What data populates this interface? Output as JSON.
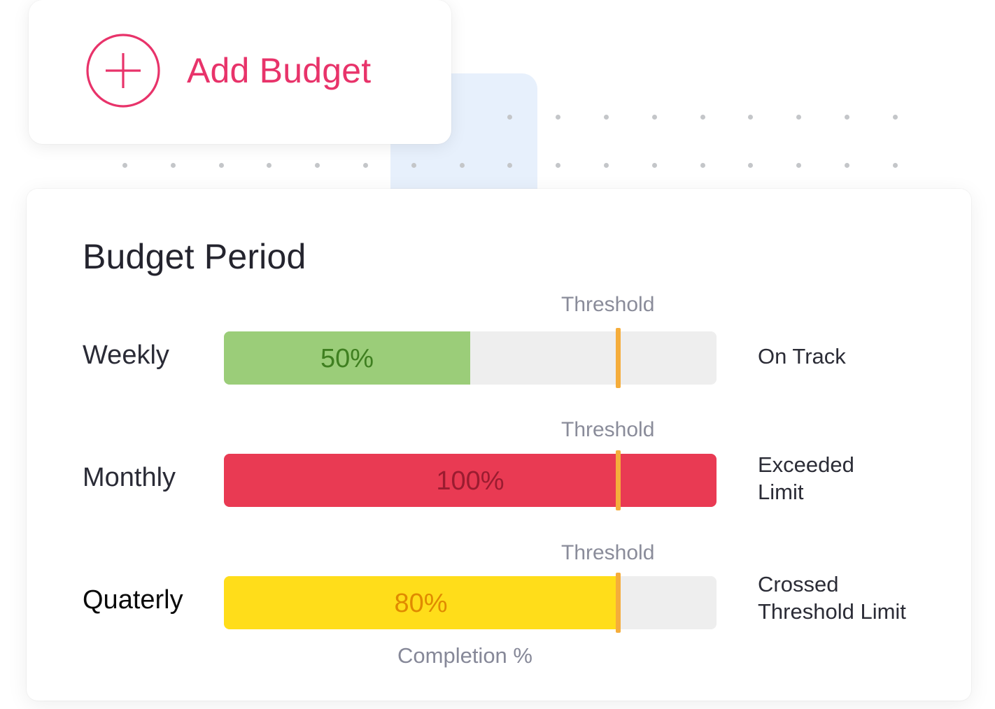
{
  "add_budget": {
    "label": "Add Budget",
    "icon": "plus-circle-icon",
    "color": "#e8336a"
  },
  "card": {
    "title": "Budget Period",
    "axis_label": "Completion %"
  },
  "chart_data": {
    "type": "bar",
    "orientation": "horizontal",
    "title": "Budget Period",
    "xlabel": "Completion %",
    "xlim": [
      0,
      100
    ],
    "threshold": 80,
    "threshold_label": "Threshold",
    "categories": [
      "Weekly",
      "Monthly",
      "Quaterly"
    ],
    "values": [
      50,
      100,
      80
    ],
    "value_labels": [
      "50%",
      "100%",
      "80%"
    ],
    "statuses": [
      "On Track",
      "Exceeded Limit",
      "Crossed Threshold Limit"
    ]
  },
  "rows": [
    {
      "label": "Weekly",
      "value": 50,
      "value_label": "50%",
      "threshold_label": "Threshold",
      "status_lines": [
        "On Track"
      ],
      "fill_color": "#9bcd79",
      "text_color": "#3f7f20"
    },
    {
      "label": "Monthly",
      "value": 100,
      "value_label": "100%",
      "threshold_label": "Threshold",
      "status_lines": [
        "Exceeded",
        "Limit"
      ],
      "fill_color": "#e93a53",
      "text_color": "#9a1c30"
    },
    {
      "label": "Quaterly",
      "value": 80,
      "value_label": "80%",
      "threshold_label": "Threshold",
      "status_lines": [
        "Crossed",
        "Threshold Limit"
      ],
      "fill_color": "#ffdd1a",
      "text_color": "#e08a00"
    }
  ],
  "colors": {
    "threshold_marker": "#f5ad3b",
    "track": "#eeeeee",
    "accent_panel": "#e7f0fc"
  }
}
